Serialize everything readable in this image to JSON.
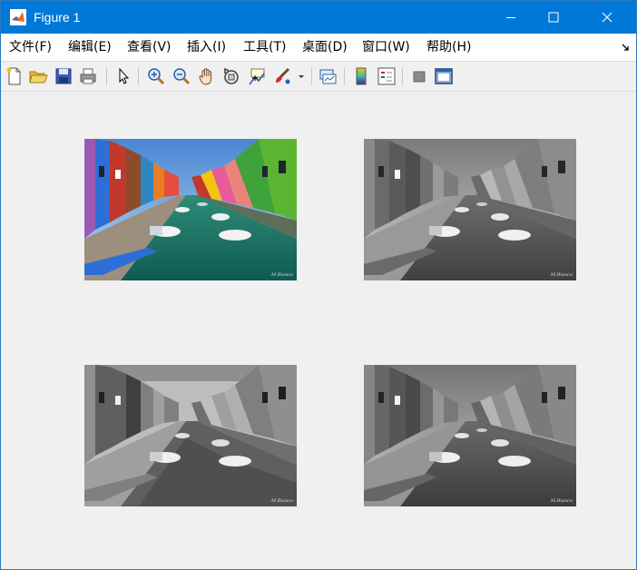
{
  "window": {
    "title": "Figure 1"
  },
  "menu": {
    "items": [
      "文件(F)",
      "编辑(E)",
      "查看(V)",
      "插入(I)",
      "工具(T)",
      "桌面(D)",
      "窗口(W)",
      "帮助(H)"
    ]
  },
  "toolbar": {
    "buttons": [
      "new-figure",
      "open-file",
      "save",
      "print",
      "edit-plot",
      "zoom-in",
      "zoom-out",
      "pan",
      "rotate-3d",
      "data-cursor",
      "brush",
      "link-plot",
      "insert-colorbar",
      "insert-legend",
      "hide-plot-tools",
      "show-plot-tools"
    ]
  },
  "colors": {
    "titlebar": "#0078d7",
    "figure_bg": "#f0f0f0"
  },
  "axes": [
    {
      "position": "top-left",
      "content": "canal photo, original color"
    },
    {
      "position": "top-right",
      "content": "canal photo, grayscale"
    },
    {
      "position": "bottom-left",
      "content": "canal photo, quantized grayscale"
    },
    {
      "position": "bottom-right",
      "content": "canal photo, grayscale"
    }
  ],
  "signature": "M.Bianco"
}
